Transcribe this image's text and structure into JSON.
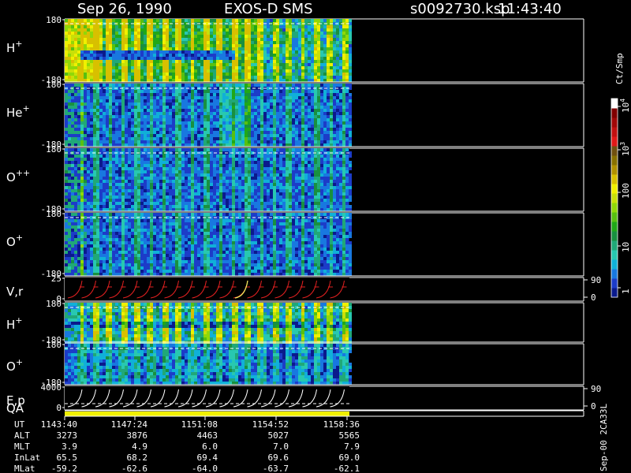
{
  "header": {
    "date": "Sep 26, 1990",
    "instrument": "EXOS-D SMS",
    "file": "s0092730.ksp",
    "time": "11:43:40"
  },
  "colorbar": {
    "unit": "Ct/Smp",
    "ticks": [
      "1",
      "10",
      "100",
      "10",
      "10"
    ],
    "tick_exponents": [
      "",
      "",
      "",
      "3",
      "4"
    ],
    "colors": [
      "#0a1a8c",
      "#1c3cc8",
      "#1878e0",
      "#10b0d8",
      "#28c8b0",
      "#20a878",
      "#189040",
      "#20a818",
      "#58c010",
      "#90d808",
      "#c8e008",
      "#f0f000",
      "#d8c000",
      "#b09000",
      "#887000",
      "#705010",
      "#e01818",
      "#c01010",
      "#a00808",
      "#800000",
      "#ffffff"
    ]
  },
  "side_label": "Sep-00 2CA33L",
  "panels": [
    {
      "id": "h-plus",
      "species": "H",
      "charge": "+",
      "ymax": "180",
      "ymin": "-180",
      "type": "h"
    },
    {
      "id": "he-plus",
      "species": "He",
      "charge": "+",
      "ymax": "180",
      "ymin": "-180",
      "type": "low"
    },
    {
      "id": "o-plus-plus",
      "species": "O",
      "charge": "++",
      "ymax": "180",
      "ymin": "-180",
      "type": "low"
    },
    {
      "id": "o-plus",
      "species": "O",
      "charge": "+",
      "ymax": "180",
      "ymin": "-180",
      "type": "low"
    },
    {
      "id": "v-r",
      "species": "V,r",
      "charge": "",
      "ymax": "25",
      "ymin": "0",
      "rmax": "90",
      "rmin": "0",
      "type": "vr"
    },
    {
      "id": "h-plus-2",
      "species": "H",
      "charge": "+",
      "ymax": "180",
      "ymin": "-180",
      "type": "h2"
    },
    {
      "id": "o-plus-2",
      "species": "O",
      "charge": "+",
      "ymax": "180",
      "ymin": "-180",
      "type": "low2"
    },
    {
      "id": "e-p",
      "species": "E,p",
      "charge": "",
      "ymax": "4000",
      "ymin": "0",
      "rmax": "90",
      "rmin": "0",
      "type": "ep"
    }
  ],
  "qa_label": "QA",
  "ephemeris": {
    "row_labels": [
      "UT",
      "ALT",
      "MLT",
      "InLat",
      "MLat"
    ],
    "columns": [
      {
        "UT": "1143:40",
        "ALT": "3273",
        "MLT": "3.9",
        "InLat": "65.5",
        "MLat": "-59.2"
      },
      {
        "UT": "1147:24",
        "ALT": "3876",
        "MLT": "4.9",
        "InLat": "68.2",
        "MLat": "-62.6"
      },
      {
        "UT": "1151:08",
        "ALT": "4463",
        "MLT": "6.0",
        "InLat": "69.4",
        "MLat": "-64.0"
      },
      {
        "UT": "1154:52",
        "ALT": "5027",
        "MLT": "7.0",
        "InLat": "69.6",
        "MLat": "-63.7"
      },
      {
        "UT": "1158:36",
        "ALT": "5565",
        "MLT": "7.9",
        "InLat": "69.0",
        "MLat": "-62.1"
      }
    ]
  }
}
